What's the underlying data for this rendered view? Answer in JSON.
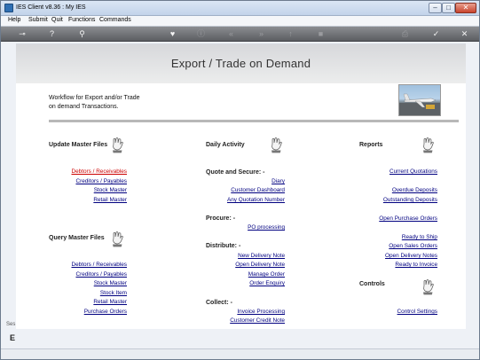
{
  "window": {
    "title": "IES Client v8.36 : My IES"
  },
  "menu": [
    "Help",
    "Submit",
    "Quit",
    "Functions",
    "Commands"
  ],
  "toolbar": {
    "icons": [
      "key-icon",
      "help-icon",
      "search-icon",
      "heart-icon",
      "info-icon",
      "back-icon",
      "forward-icon",
      "up-icon",
      "stop-icon",
      "print-icon",
      "ok-icon",
      "close-icon"
    ]
  },
  "page": {
    "title": "Export / Trade on Demand",
    "description_line1": "Workflow for Export and/or Trade",
    "description_line2": "on demand Transactions."
  },
  "update_master": {
    "heading": "Update Master Files",
    "links": [
      "Debtors / Receivables",
      "Creditors / Payables",
      "Stock Master",
      "Retail Master"
    ]
  },
  "query_master": {
    "heading": "Query Master Files",
    "links": [
      "Debtors / Receivables",
      "Creditors / Payables",
      "Stock Master",
      "Stock Item",
      "Retail Master",
      "Purchase Orders"
    ]
  },
  "daily": {
    "heading": "Daily Activity",
    "quote_heading": "Quote and Secure: -",
    "quote_links": [
      "Diary",
      "Customer Dashboard",
      "Any Quotation Number"
    ],
    "procure_heading": "Procure: -",
    "procure_links": [
      "PO processing"
    ],
    "distribute_heading": "Distribute: -",
    "distribute_links": [
      "New Delivery Note",
      "Open Delivery Note",
      "Manage Order",
      "Order Enquiry"
    ],
    "collect_heading": "Collect: -",
    "collect_links": [
      "Invoice Processing",
      "Customer Credit Note"
    ]
  },
  "reports": {
    "heading": "Reports",
    "links": [
      "Current Quotations",
      "Overdue Deposits",
      "Outstanding Deposits",
      "Open Purchase Orders",
      "Ready to Ship",
      "Open Sales Orders",
      "Open Delivery Notes",
      "Ready to Invoice"
    ]
  },
  "controls": {
    "heading": "Controls",
    "links": [
      "Control Settings"
    ]
  },
  "side_fragment": {
    "top": "Ses",
    "bottom": "E"
  }
}
